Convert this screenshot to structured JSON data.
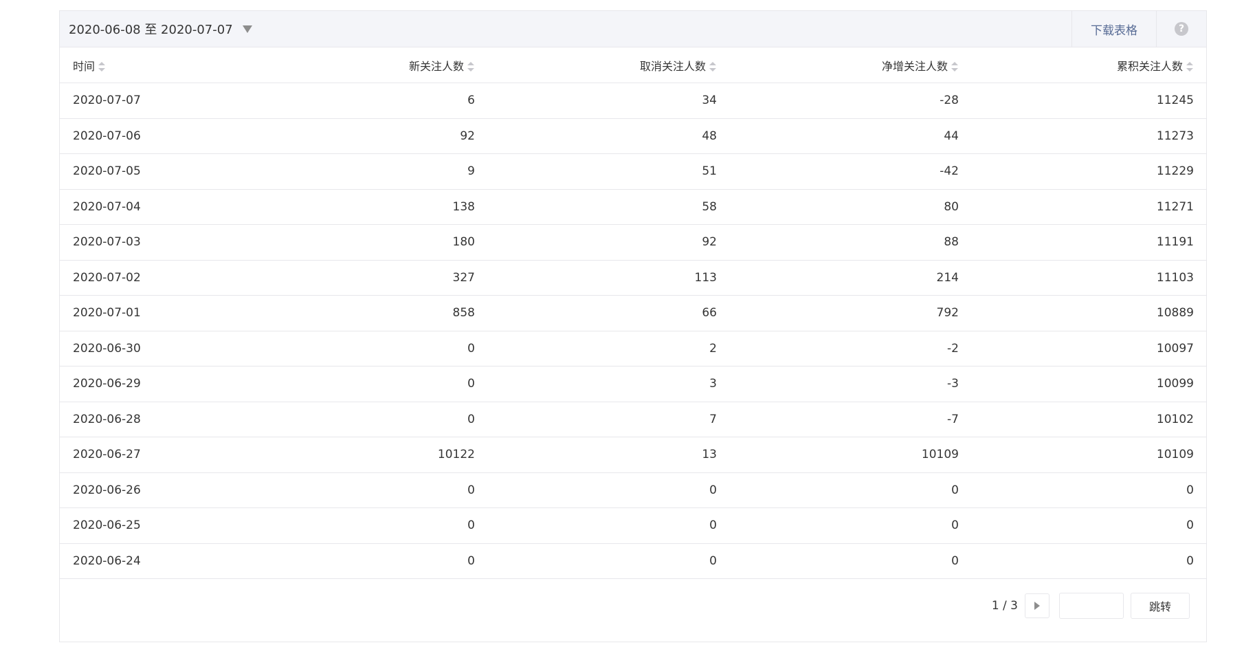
{
  "toolbar": {
    "date_range": "2020-06-08 至 2020-07-07",
    "download_label": "下载表格",
    "help_label": "?"
  },
  "table": {
    "columns": [
      "时间",
      "新关注人数",
      "取消关注人数",
      "净增关注人数",
      "累积关注人数"
    ],
    "rows": [
      [
        "2020-07-07",
        "6",
        "34",
        "-28",
        "11245"
      ],
      [
        "2020-07-06",
        "92",
        "48",
        "44",
        "11273"
      ],
      [
        "2020-07-05",
        "9",
        "51",
        "-42",
        "11229"
      ],
      [
        "2020-07-04",
        "138",
        "58",
        "80",
        "11271"
      ],
      [
        "2020-07-03",
        "180",
        "92",
        "88",
        "11191"
      ],
      [
        "2020-07-02",
        "327",
        "113",
        "214",
        "11103"
      ],
      [
        "2020-07-01",
        "858",
        "66",
        "792",
        "10889"
      ],
      [
        "2020-06-30",
        "0",
        "2",
        "-2",
        "10097"
      ],
      [
        "2020-06-29",
        "0",
        "3",
        "-3",
        "10099"
      ],
      [
        "2020-06-28",
        "0",
        "7",
        "-7",
        "10102"
      ],
      [
        "2020-06-27",
        "10122",
        "13",
        "10109",
        "10109"
      ],
      [
        "2020-06-26",
        "0",
        "0",
        "0",
        "0"
      ],
      [
        "2020-06-25",
        "0",
        "0",
        "0",
        "0"
      ],
      [
        "2020-06-24",
        "0",
        "0",
        "0",
        "0"
      ]
    ]
  },
  "pager": {
    "page_info": "1 / 3",
    "jump_label": "跳转",
    "page_input_value": ""
  },
  "colors": {
    "link": "#576b95",
    "border": "#e7e7eb",
    "toolbar_bg": "#f4f5f9",
    "text": "#353535"
  },
  "icons": {
    "date_dropdown": "caret-down-icon",
    "sort": "sort-icon",
    "help": "help-icon",
    "next_page": "chevron-right-icon"
  }
}
